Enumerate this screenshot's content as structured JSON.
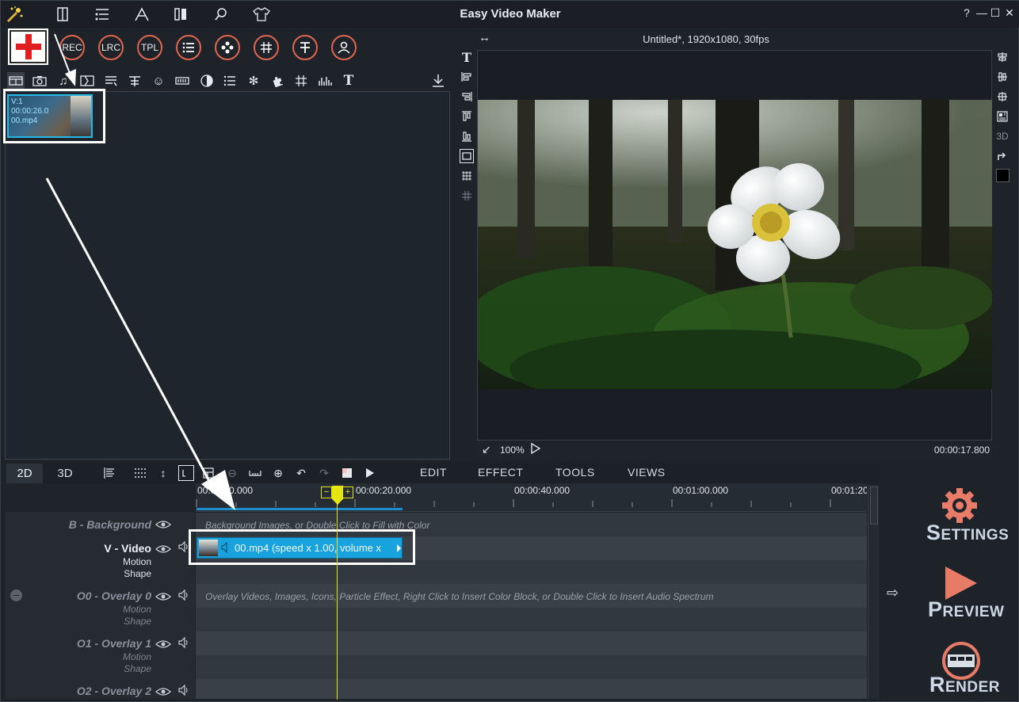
{
  "app": {
    "title": "Easy Video Maker",
    "help": "?",
    "minimize": "—",
    "maximize": "☐",
    "close": "✕"
  },
  "toolbar": {
    "rec": "REC",
    "lrc": "LRC",
    "tpl": "TPL"
  },
  "media": {
    "item": {
      "line1": "V:1",
      "line2": "00:00:26.0",
      "line3": "00.mp4"
    }
  },
  "preview": {
    "header": "Untitled*, 1920x1080, 30fps",
    "zoom": "100%",
    "time": "00:00:17.800",
    "side_3d": "3D"
  },
  "timeline": {
    "tab_2d": "2D",
    "tab_3d": "3D",
    "menu": [
      "EDIT",
      "EFFECT",
      "TOOLS",
      "VIEWS"
    ],
    "ticks": [
      "00:00:00.000",
      "00:00:20.000",
      "00:00:40.000",
      "00:01:00.000",
      "00:01:20"
    ],
    "tracks": {
      "background": {
        "name": "B - Background",
        "hint": "Background Images, or Double Click to Fill with Color"
      },
      "video": {
        "name": "V - Video",
        "sub1": "Motion",
        "sub2": "Shape"
      },
      "overlay0": {
        "name": "O0 - Overlay 0",
        "sub1": "Motion",
        "sub2": "Shape",
        "hint": "Overlay Videos, Images, Icons, Particle Effect, Right Click to Insert Color Block, or Double  Click to Insert Audio Spectrum"
      },
      "overlay1": {
        "name": "O1 - Overlay 1",
        "sub1": "Motion",
        "sub2": "Shape"
      },
      "overlay2": {
        "name": "O2 - Overlay 2"
      }
    },
    "clip_label": "00.mp4  (speed x 1.00, volume x"
  },
  "actions": {
    "settings": {
      "cap": "S",
      "rest": "ETTINGS"
    },
    "preview": {
      "cap": "P",
      "rest": "REVIEW"
    },
    "render": {
      "cap": "R",
      "rest": "ENDER"
    }
  },
  "colors": {
    "accent_orange": "#e0664f",
    "clip_blue": "#19a3de",
    "playhead_yellow": "#e5e512",
    "bg": "#1e232a"
  }
}
